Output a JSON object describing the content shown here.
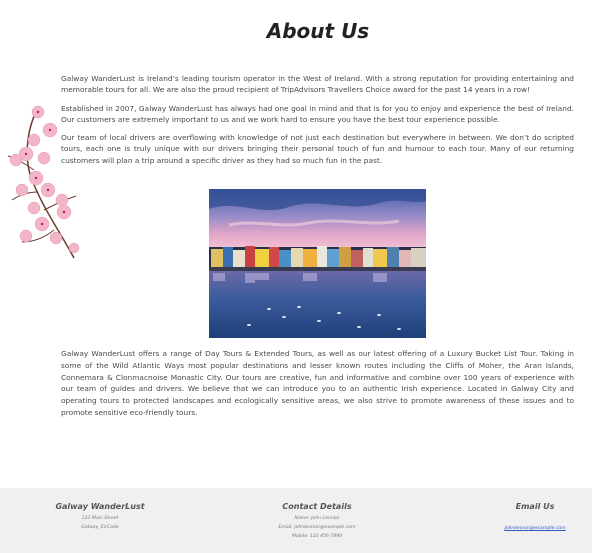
{
  "page": {
    "title": "About Us"
  },
  "intro_paragraphs": [
    "Galway WanderLust is Ireland’s leading tourism operator in the West of Ireland. With a strong reputation for providing entertaining and memorable tours for all. We are also the proud recipient of TripAdvisors Travellers Choice award for the past 14 years in a row!",
    "Established in 2007, Galway WanderLust has always had one goal in mind and that is for you to enjoy and experience the best of Ireland. Our customers are extremely important to us and we work hard to ensure you have the best tour experience possible.",
    "Our team of local drivers are overflowing with knowledge of not just each destination but everywhere in between. We don’t do scripted tours, each one is truly unique with our drivers bringing their personal touch of fun and humour to each tour. Many of our returning customers will plan a trip around a specific driver as they had so much fun in the past."
  ],
  "closing_paragraph": "Galway WanderLust offers a range of Day Tours & Extended Tours, as well as our latest offering of a Luxury Bucket List Tour. Taking in some of the Wild Atlantic Ways most popular destinations and lesser known routes including the Cliffs of Moher, the Aran Islands, Connemara & Clonmacnoise Monastic City. Our tours are creative, fun and informative and combine over 100 years of experience with our team of guides and drivers. We believe that we can introduce you to an authentic Irish experience. Located in Galway City and operating tours to protected landscapes and ecologically sensitive areas, we also strive to promote awareness of these issues and to promote sensitive eco-friendly tours.",
  "footer": {
    "company": {
      "heading": "Galway WanderLust",
      "street": "123 Main Street",
      "city": "Galway, EirCode"
    },
    "contact": {
      "heading": "Contact Details",
      "name": "Name: John Lennon",
      "email": "Email: johnlennon@example.com",
      "mobile": "Mobile: 123 456 7890"
    },
    "email_us": {
      "heading": "Email Us",
      "link": "johnlennon@example.com"
    }
  },
  "colors": {
    "footer_bg": "#f0f0f0",
    "link": "#3355cc"
  },
  "icons": {
    "decoration": "cherry-blossom-branch-icon",
    "hero": "galway-harbour-image"
  }
}
